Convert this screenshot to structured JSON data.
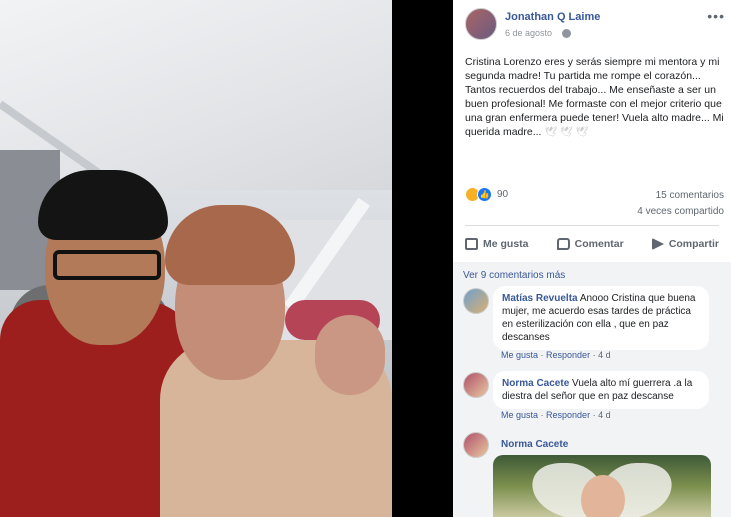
{
  "post": {
    "author": "Jonathan Q Laime",
    "date": "6 de agosto",
    "more_label": "•••",
    "text": "Cristina Lorenzo eres y serás siempre mi mentora y mi segunda madre! Tu partida me rompe el corazón... Tantos recuerdos del trabajo... Me enseñaste a ser un buen profesional! Me formaste con el mejor criterio que una gran enfermera puede tener! Vuela alto madre... Mi querida madre...",
    "text_emoji": "🕊 🕊 🕊",
    "reaction_count": "90",
    "comments_count": "15 comentarios",
    "shares_count": "4 veces compartido"
  },
  "actions": {
    "like": "Me gusta",
    "comment": "Comentar",
    "share": "Compartir"
  },
  "comments": {
    "view_more": "Ver 9 comentarios más",
    "like_label": "Me gusta",
    "reply_label": "Responder",
    "items": [
      {
        "name": "Matías Revuelta",
        "text": "Anooo Cristina que buena mujer, me acuerdo esas tardes de práctica en esterilización con ella , que en paz descanses",
        "time": "4 d"
      },
      {
        "name": "Norma Cacete",
        "text": "Vuela alto mí guerrera .a la diestra del señor que en paz descanse",
        "time": "4 d"
      },
      {
        "name": "Norma Cacete"
      }
    ]
  },
  "colors": {
    "link": "#385898",
    "like_blue": "#1877f2",
    "sad_yellow": "#f7b125",
    "comments_bg": "#f2f3f5"
  }
}
